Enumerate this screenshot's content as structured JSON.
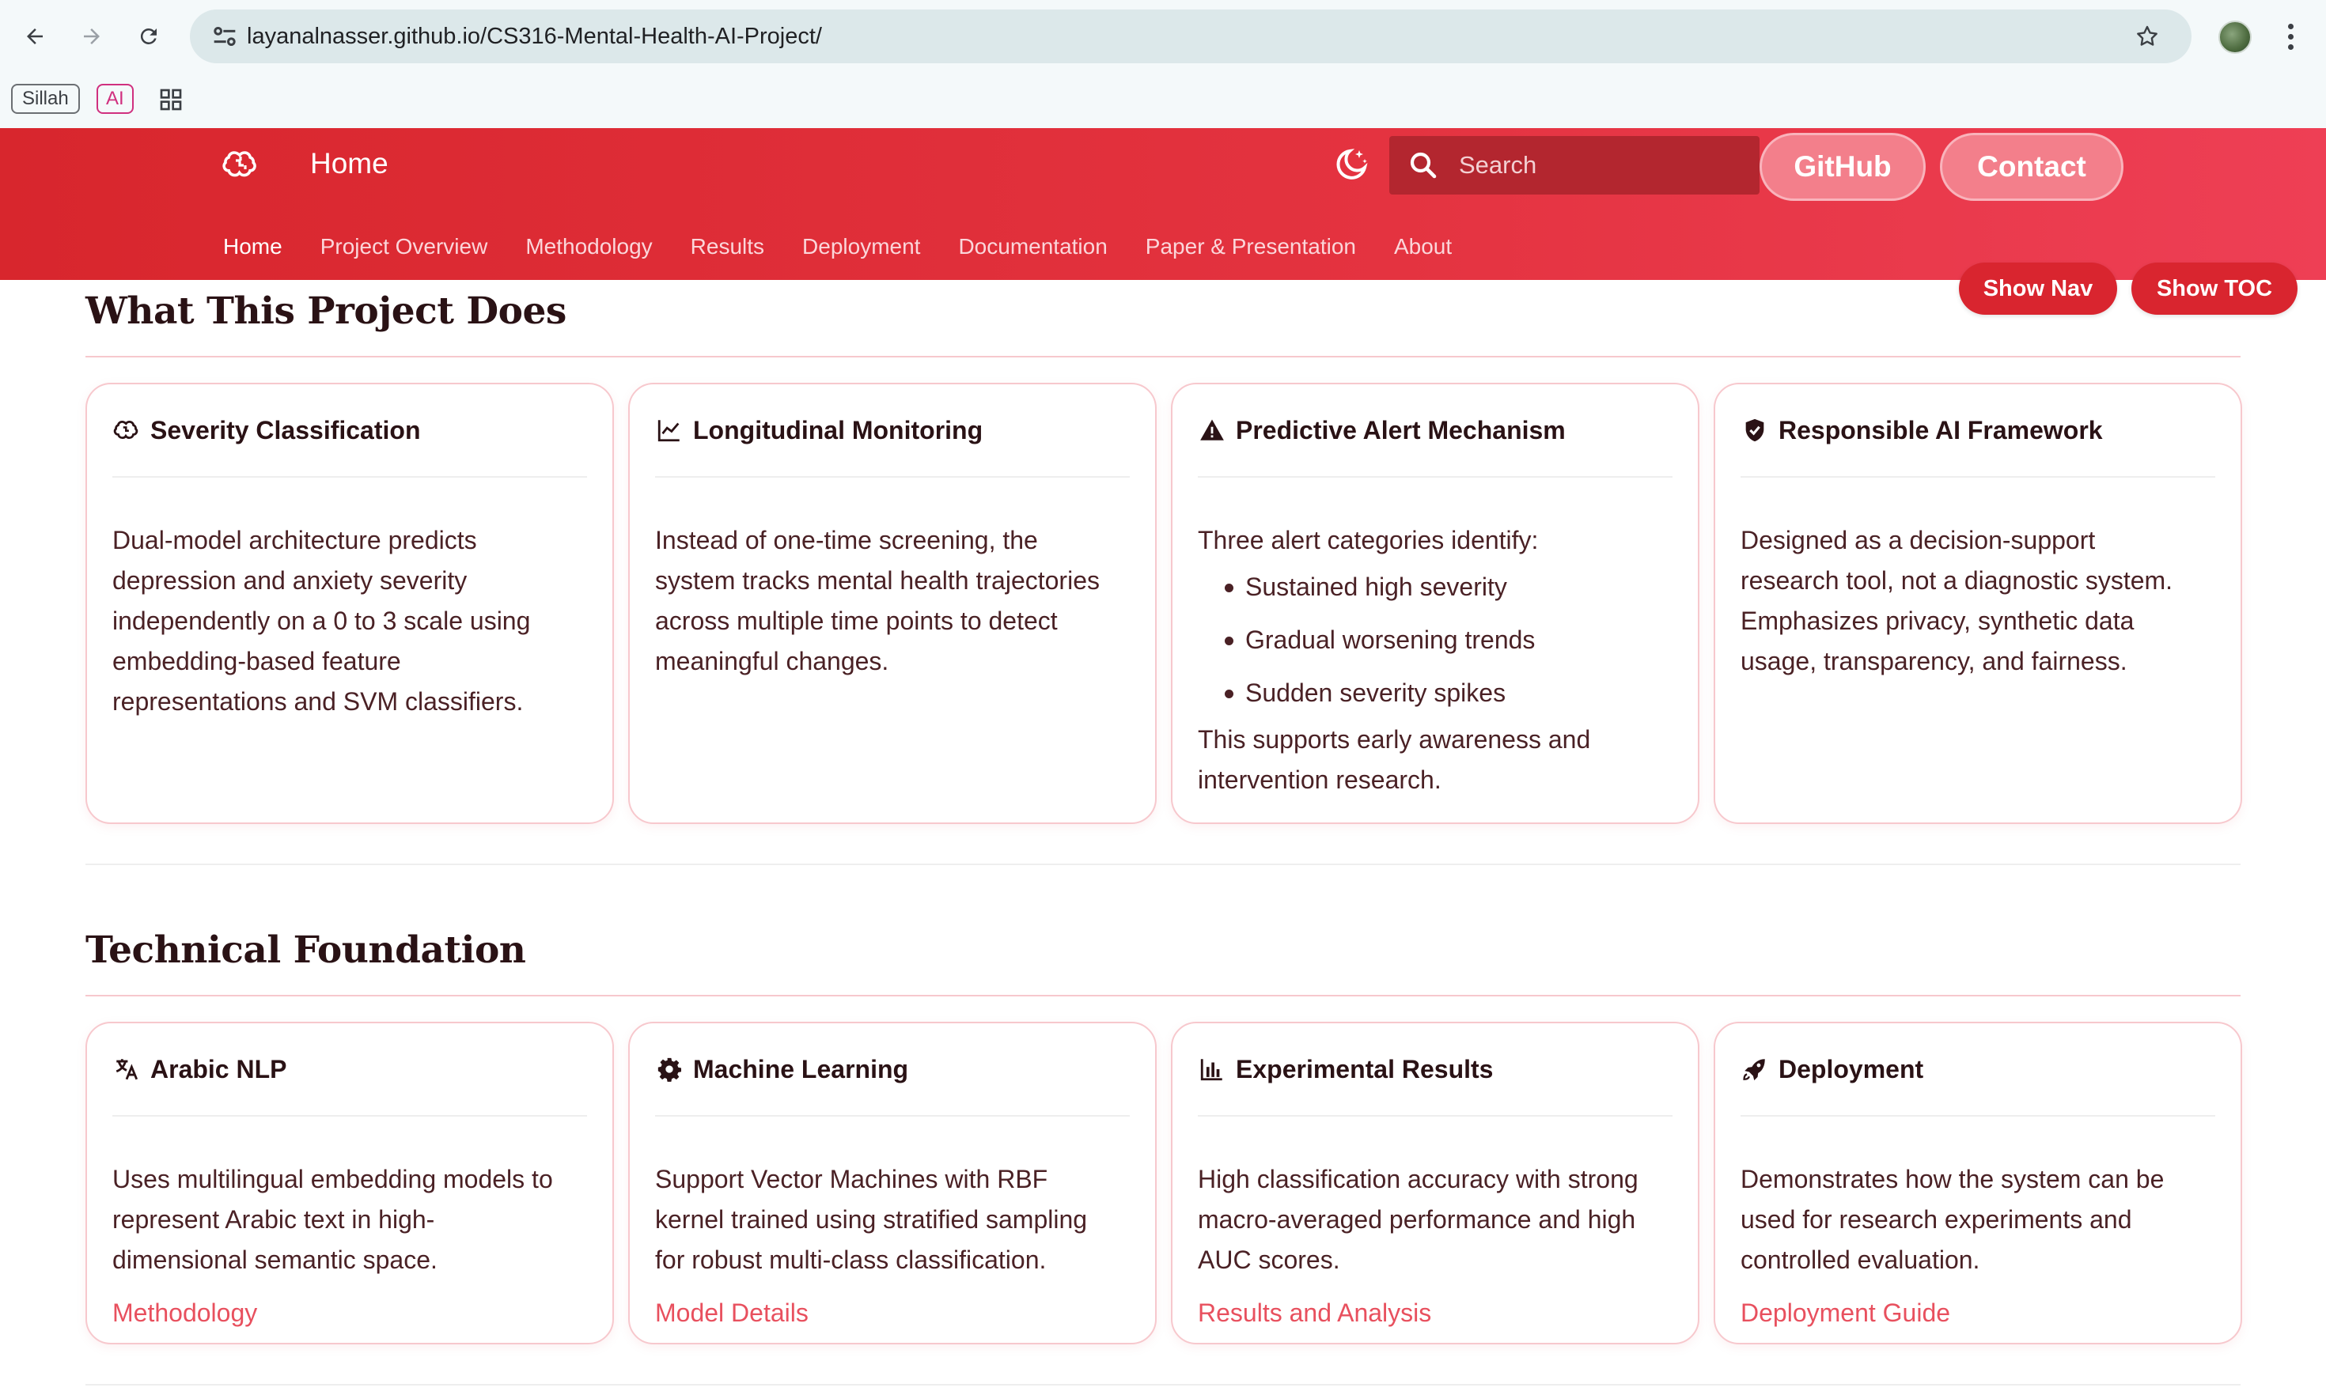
{
  "browser": {
    "url_host": "layanalnasser.github.io",
    "url_path": "/CS316-Mental-Health-AI-Project/",
    "bookmarks": [
      "Sillah",
      "AI"
    ]
  },
  "header": {
    "brand": "Home",
    "search_placeholder": "Search",
    "github_label": "GitHub",
    "contact_label": "Contact",
    "nav": [
      "Home",
      "Project Overview",
      "Methodology",
      "Results",
      "Deployment",
      "Documentation",
      "Paper & Presentation",
      "About"
    ],
    "active_nav": "Home",
    "show_nav_label": "Show Nav",
    "show_toc_label": "Show TOC"
  },
  "sections": [
    {
      "title": "What This Project Does",
      "cards": [
        {
          "icon": "brain-icon",
          "title": "Severity Classification",
          "lines": [
            "Dual-model architecture predicts",
            "depression and anxiety severity",
            "independently on a 0 to 3 scale using",
            "embedding-based feature",
            "representations and SVM classifiers."
          ]
        },
        {
          "icon": "chart-line-icon",
          "title": "Longitudinal Monitoring",
          "lines": [
            "Instead of one-time screening, the",
            "system tracks mental health trajectories",
            "across multiple time points to detect",
            "meaningful changes."
          ]
        },
        {
          "icon": "warning-icon",
          "title": "Predictive Alert Mechanism",
          "intro": "Three alert categories identify:",
          "bullets": [
            "Sustained high severity",
            "Gradual worsening trends",
            "Sudden severity spikes"
          ],
          "outro": [
            "This supports early awareness and",
            "intervention research."
          ]
        },
        {
          "icon": "shield-check-icon",
          "title": "Responsible AI Framework",
          "lines": [
            "Designed as a decision-support",
            "research tool, not a diagnostic system.",
            "Emphasizes privacy, synthetic data",
            "usage, transparency, and fairness."
          ]
        }
      ]
    },
    {
      "title": "Technical Foundation",
      "cards": [
        {
          "icon": "translate-icon",
          "title": "Arabic NLP",
          "lines": [
            "Uses multilingual embedding models to",
            "represent Arabic text in high-",
            "dimensional semantic space."
          ],
          "link": "Methodology"
        },
        {
          "icon": "gear-icon",
          "title": "Machine Learning",
          "lines": [
            "Support Vector Machines with RBF",
            "kernel trained using stratified sampling",
            "for robust multi-class classification."
          ],
          "link": "Model Details"
        },
        {
          "icon": "bar-chart-icon",
          "title": "Experimental Results",
          "lines": [
            "High classification accuracy with strong",
            "macro-averaged performance and high",
            "AUC scores."
          ],
          "link": "Results and Analysis"
        },
        {
          "icon": "rocket-icon",
          "title": "Deployment",
          "lines": [
            "Demonstrates how the system can be",
            "used for research experiments and",
            "controlled evaluation."
          ],
          "link": "Deployment Guide"
        }
      ]
    }
  ]
}
